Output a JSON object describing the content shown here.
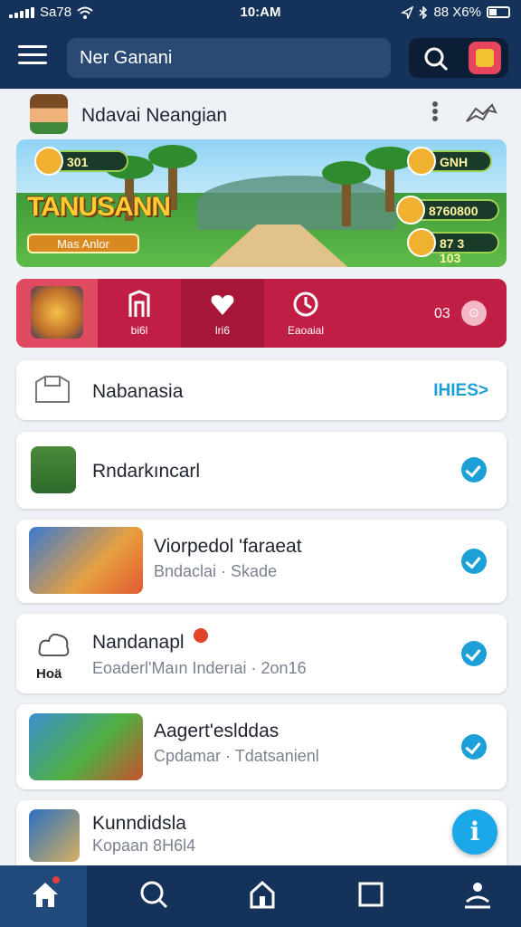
{
  "status_bar": {
    "carrier": "Sa78",
    "time": "10:AM",
    "battery_text": "88 X6%"
  },
  "header": {
    "search_value": "Ner Ganani"
  },
  "profile": {
    "name": "Ndavai Neangian"
  },
  "banner": {
    "title": "TANUSANN",
    "button_label": "Mas Anlor",
    "stats": [
      "301",
      "GNH",
      "8760800",
      "87 3 103"
    ]
  },
  "action_bar": {
    "items": [
      {
        "label": "bi6l"
      },
      {
        "label": "lri6"
      },
      {
        "label": "Eaoaial"
      }
    ],
    "count": "03"
  },
  "list": {
    "header": {
      "title": "Nabanasia",
      "link": "IHIES>"
    },
    "items": [
      {
        "title": "Rndarkıncarl",
        "subtitle": ""
      },
      {
        "title": "Viorpedol 'faraeat",
        "subtitle": "Bndaclai · Skade"
      },
      {
        "title": "Nandanapl",
        "subtitle": "Eoaderl'Maın Inderıai · 2on16",
        "thumb_label": "Hoä"
      },
      {
        "title": "Aagert'eslddas",
        "subtitle": "Cpdamar · Tdatsanienl"
      },
      {
        "title": "Kunndidsla",
        "subtitle": "Kopaan 8H6l4"
      }
    ]
  },
  "fab": {
    "label": "i"
  },
  "colors": {
    "header": "#14325a",
    "accent": "#1d9fd8",
    "action_bar": "#c01e44"
  },
  "bottom_nav": [
    "home-icon",
    "search-icon",
    "house-icon",
    "square-icon",
    "people-icon"
  ]
}
